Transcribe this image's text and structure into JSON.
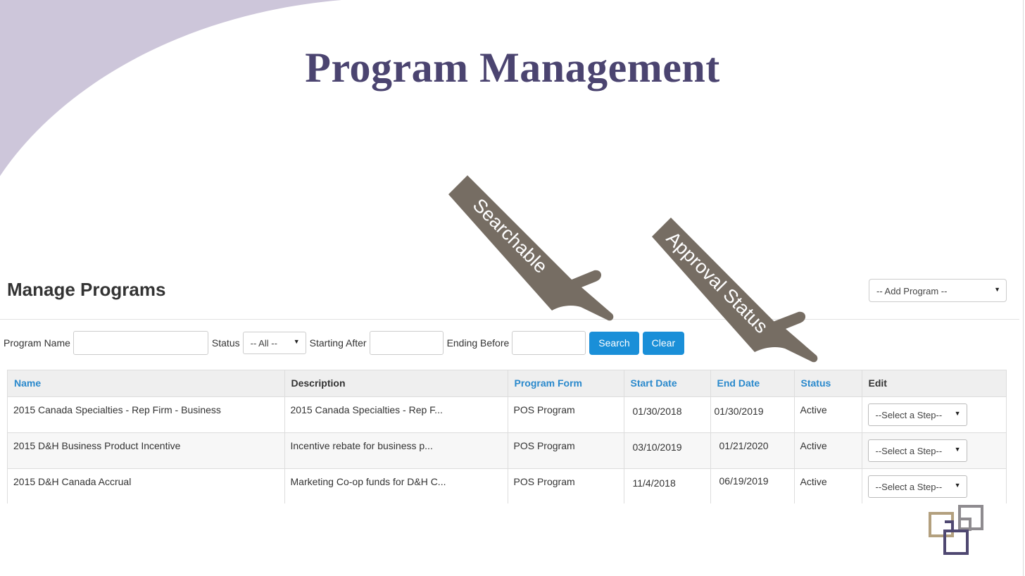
{
  "slide": {
    "title": "Program Management"
  },
  "callouts": {
    "searchable": "Searchable",
    "approval": "Approval Status"
  },
  "page": {
    "heading": "Manage Programs",
    "add_program": "-- Add Program --"
  },
  "filters": {
    "program_name_label": "Program Name",
    "program_name_value": "",
    "status_label": "Status",
    "status_selected": "-- All --",
    "starting_after_label": "Starting After",
    "starting_after_value": "",
    "ending_before_label": "Ending Before",
    "ending_before_value": "",
    "search_label": "Search",
    "clear_label": "Clear"
  },
  "table": {
    "columns": [
      "Name",
      "Description",
      "Program Form",
      "Start Date",
      "End Date",
      "Status",
      "Edit"
    ],
    "rows": [
      {
        "name": "2015 Canada Specialties - Rep Firm - Business",
        "description": "2015 Canada Specialties - Rep F...",
        "form": "POS Program",
        "start": "01/30/2018",
        "end": "01/30/2019",
        "status": "Active",
        "edit": "--Select a Step--"
      },
      {
        "name": "2015 D&H Business Product Incentive",
        "description": "Incentive rebate for business p...",
        "form": "POS Program",
        "start": "03/10/2019",
        "end": "01/21/2020",
        "status": "Active",
        "edit": "--Select a Step--"
      },
      {
        "name": "2015 D&H Canada Accrual",
        "description": "Marketing Co-op funds for D&H C...",
        "form": "POS Program",
        "start": "11/4/2018",
        "end": "06/19/2019",
        "status": "Active",
        "edit": "--Select a Step--"
      }
    ]
  },
  "colors": {
    "title": "#4b4470",
    "swoosh": "#cdc6da",
    "callout": "#766d63",
    "link": "#2a89cc",
    "button": "#1a8fd8",
    "logo_tan": "#b3a07e",
    "logo_gray": "#8e8b8f",
    "logo_purple": "#4f4871"
  },
  "icons": {
    "caret": "caret-down-icon",
    "logo": "squares-logo-icon",
    "pointer": "pointing-hand-icon"
  }
}
